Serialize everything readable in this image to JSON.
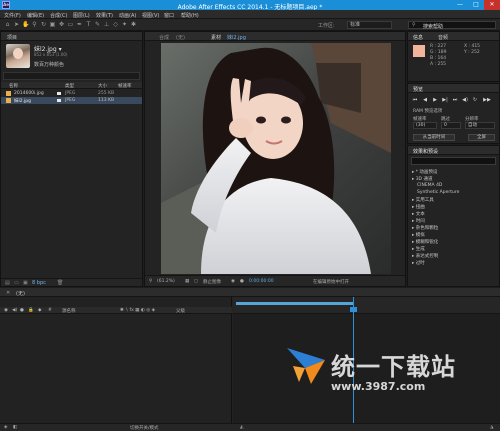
{
  "titlebar": {
    "title": "Adobe After Effects CC 2014.1 - 无标题项目.aep *",
    "app_icon": "Ae",
    "buttons": [
      "—",
      "□",
      "✕"
    ]
  },
  "menubar": {
    "items": [
      "文件(F)",
      "编辑(E)",
      "合成(C)",
      "图层(L)",
      "效果(T)",
      "动画(A)",
      "视图(V)",
      "窗口",
      "帮助(H)"
    ]
  },
  "toolbar": {
    "workspace_label": "工作区:",
    "workspace_value": "标准",
    "search_placeholder": "搜索帮助"
  },
  "project": {
    "tab": "项目",
    "file_name": "妹l2.jpg ▾",
    "file_size": "852 x 853 (1.00)",
    "file_meta": "数百万种颜色",
    "file_desc": "数百万种颜色",
    "columns": [
      "名称",
      "类型",
      "大小",
      "帧速率"
    ],
    "rows": [
      {
        "name": "2014600i.jpg",
        "type": "JPEG",
        "size": "255 KB"
      },
      {
        "name": "妹l2.jpg",
        "type": "JPEG",
        "size": "113 KB"
      }
    ],
    "footer_depth": "8 bpc"
  },
  "viewer": {
    "tabs": [
      "合成",
      "(无)",
      "素材",
      "妹l2.jpg"
    ],
    "zoom": "(61.2%)",
    "footer_text": "静止图像",
    "footer_time": "0:00:00:00",
    "footer_right": "在编辑原始中打开"
  },
  "info": {
    "tab_info": "信息",
    "tab_audio": "音频",
    "color": "#f4b49a",
    "r": "R : 227",
    "g": "G : 189",
    "b": "B : 164",
    "a": "A : 255",
    "x": "X : 415",
    "y": "Y : 252"
  },
  "preview": {
    "tab": "预览",
    "ram_label": "RAM 预览选项",
    "frame_rate_label": "帧速率",
    "skip_label": "跳过",
    "resolution_label": "分辨率",
    "frame_rate_value": "(30)",
    "skip_value": "0",
    "resolution_value": "自动",
    "from_current": "从当前时间",
    "full_screen": "全屏"
  },
  "effects": {
    "tab": "效果和预设",
    "items": [
      "▸ * 动画预设",
      "▸ 3D 通道",
      "CINEMA 4D",
      "Synthetic Aperture",
      "▸ 实用工具",
      "▸ 扭曲",
      "▸ 文本",
      "▸ 时间",
      "▸ 杂色和颗粒",
      "▸ 模拟",
      "▸ 模糊和锐化",
      "▸ 生成",
      "▸ 表达式控制",
      "▸ 过时"
    ]
  },
  "timeline": {
    "tab": "(无)",
    "col_source": "源名称",
    "col_parent": "父级",
    "footer": "切换开关/模式"
  },
  "watermark": {
    "title": "统一下载站",
    "url": "www.3987.com"
  }
}
